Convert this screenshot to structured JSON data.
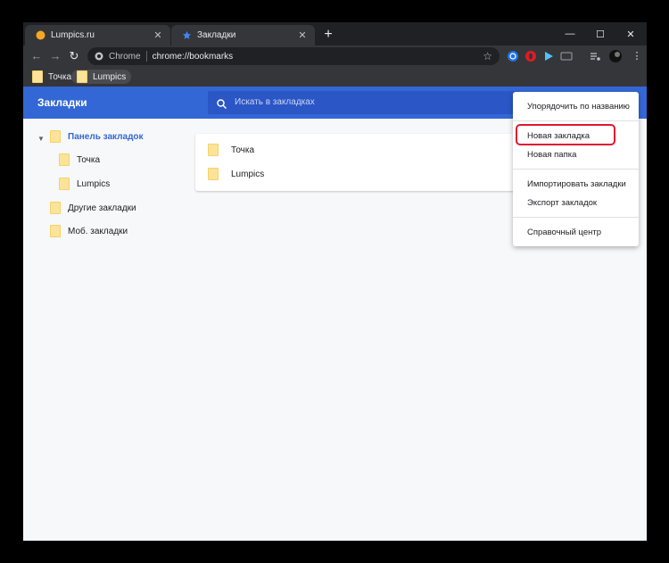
{
  "tabs": [
    {
      "title": "Lumpics.ru",
      "active": false
    },
    {
      "title": "Закладки",
      "active": true
    }
  ],
  "address_bar": {
    "site_label": "Chrome",
    "url": "chrome://bookmarks"
  },
  "bookmarks_bar": [
    {
      "label": "Точка"
    },
    {
      "label": "Lumpics"
    }
  ],
  "header": {
    "title": "Закладки",
    "search_placeholder": "Искать в закладках"
  },
  "sidebar": {
    "items": [
      {
        "label": "Панель закладок"
      },
      {
        "label": "Точка"
      },
      {
        "label": "Lumpics"
      },
      {
        "label": "Другие закладки"
      },
      {
        "label": "Моб. закладки"
      }
    ]
  },
  "list": {
    "items": [
      {
        "label": "Точка"
      },
      {
        "label": "Lumpics"
      }
    ]
  },
  "menu": {
    "items": [
      {
        "label": "Упорядочить по названию"
      },
      {
        "label": "Новая закладка"
      },
      {
        "label": "Новая папка"
      },
      {
        "label": "Импортировать закладки"
      },
      {
        "label": "Экспорт закладок"
      },
      {
        "label": "Справочный центр"
      }
    ]
  },
  "colors": {
    "accent": "#3367d6",
    "highlight": "#e0172f",
    "folder": "#fbe49a"
  }
}
